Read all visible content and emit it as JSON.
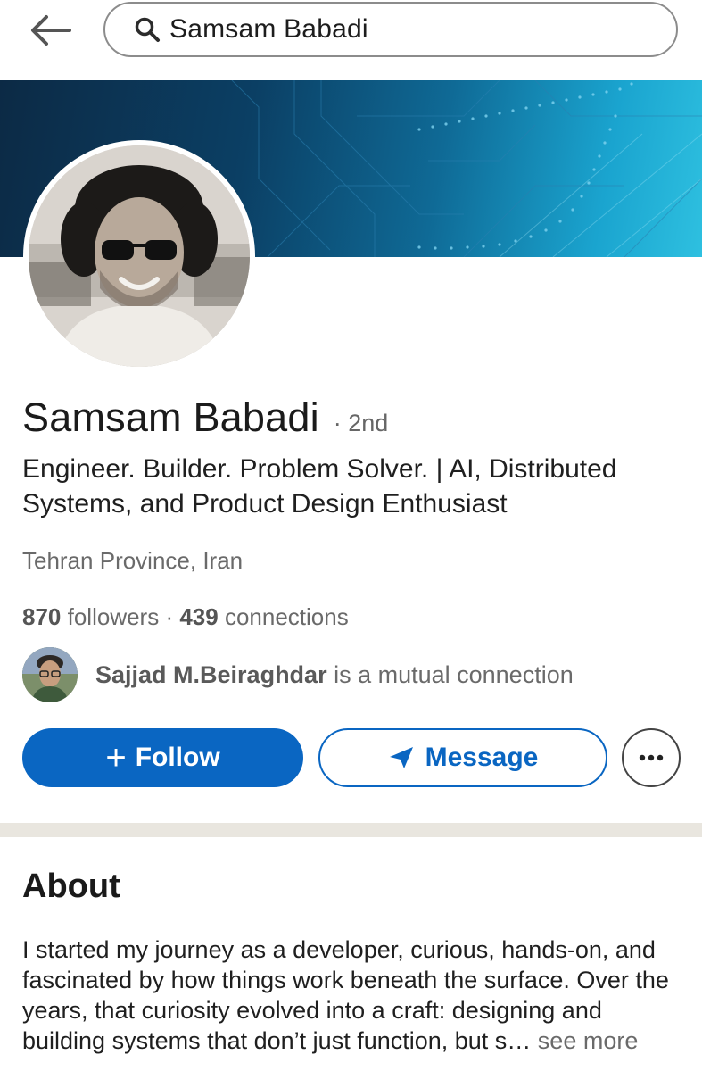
{
  "search": {
    "query": "Samsam Babadi"
  },
  "profile": {
    "name": "Samsam Babadi",
    "degree": "· 2nd",
    "headline": "Engineer. Builder. Problem Solver. | AI, Distributed Systems, and Product Design Enthusiast",
    "location": "Tehran Province, Iran",
    "followers_count": "870",
    "followers_label": "followers",
    "separator": " · ",
    "connections_count": "439",
    "connections_label": "connections"
  },
  "mutual": {
    "name": "Sajjad M.Beiraghdar",
    "suffix": " is a mutual connection"
  },
  "actions": {
    "follow_plus": "+",
    "follow_label": "Follow",
    "message_label": "Message"
  },
  "about": {
    "title": "About",
    "body": "I started my journey as a developer, curious, hands-on, and fascinated by how things work beneath the surface. Over the years, that curiosity evolved into a craft: designing and building systems that don’t just function, but s…",
    "see_more": " see more"
  },
  "colors": {
    "brand_blue": "#0a66c2",
    "divider": "#e9e6df"
  },
  "icons": [
    "back-arrow-icon",
    "search-icon",
    "send-icon",
    "more-dots-icon"
  ]
}
